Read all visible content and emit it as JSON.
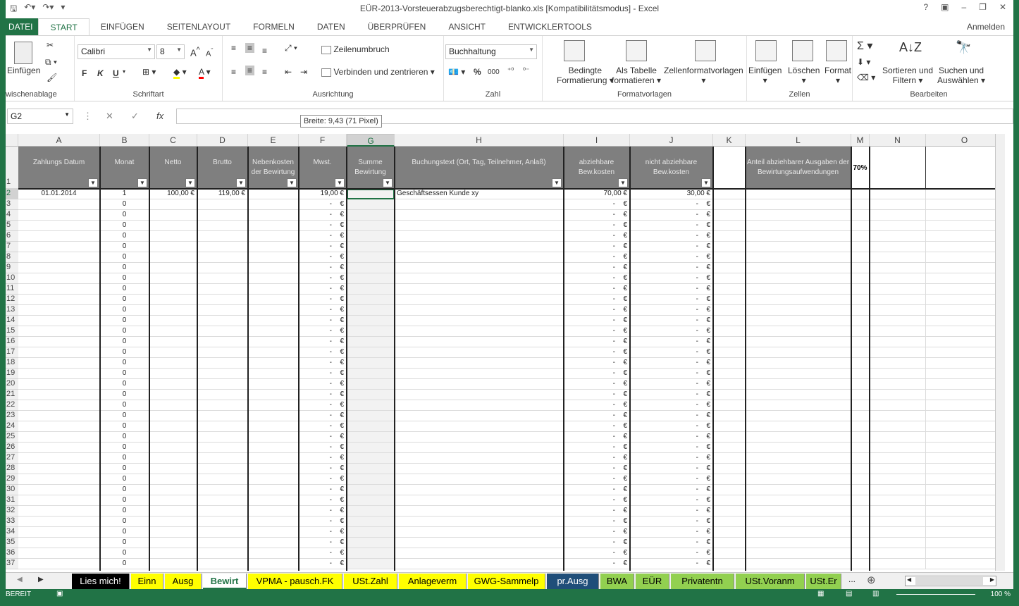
{
  "window": {
    "title": "EÜR-2013-Vorsteuerabzugsberechtigt-blanko.xls  [Kompatibilitätsmodus] - Excel"
  },
  "ribbon": {
    "tabs": [
      "DATEI",
      "START",
      "EINFÜGEN",
      "SEITENLAYOUT",
      "FORMELN",
      "DATEN",
      "ÜBERPRÜFEN",
      "ANSICHT",
      "ENTWICKLERTOOLS"
    ],
    "active_tab": "START",
    "signin": "Anmelden",
    "clipboard": {
      "paste": "Einfügen",
      "label": "wischenablage"
    },
    "font": {
      "name": "Calibri",
      "size": "8",
      "bold": "F",
      "italic": "K",
      "underline": "U",
      "label": "Schriftart"
    },
    "alignment": {
      "wrap": "Zeilenumbruch",
      "merge": "Verbinden und zentrieren",
      "label": "Ausrichtung"
    },
    "number": {
      "format": "Buchhaltung",
      "percent": "%",
      "thousands": "000",
      "label": "Zahl"
    },
    "styles": {
      "conditional_1": "Bedingte",
      "conditional_2": "Formatierung",
      "table_1": "Als Tabelle",
      "table_2": "formatieren",
      "cellstyles": "Zellenformatvorlagen",
      "label": "Formatvorlagen"
    },
    "cells": {
      "insert": "Einfügen",
      "delete": "Löschen",
      "format": "Format",
      "label": "Zellen"
    },
    "editing": {
      "sort_1": "Sortieren und",
      "sort_2": "Filtern",
      "find_1": "Suchen und",
      "find_2": "Auswählen",
      "label": "Bearbeiten"
    }
  },
  "formula_bar": {
    "name_box": "G2",
    "fx": "fx",
    "tooltip": "Breite: 9,43 (71 Pixel)"
  },
  "columns": [
    "A",
    "B",
    "C",
    "D",
    "E",
    "F",
    "G",
    "H",
    "I",
    "J",
    "K",
    "L",
    "M",
    "N",
    "O"
  ],
  "headers": {
    "A": "Zahlungs Datum",
    "B": "Monat",
    "C": "Netto",
    "D": "Brutto",
    "E": "Nebenkosten der Bewirtung",
    "F": "Mwst.",
    "G": "Summe Bewirtung",
    "H": "Buchungstext (Ort, Tag, Teilnehmer, Anlaß)",
    "I": "abziehbare Bew.kosten",
    "J": "nicht abziehbare Bew.kosten",
    "L": "Anteil abziehbarer Ausgaben der Bewirtungsaufwendungen",
    "M": "70%"
  },
  "first_row": {
    "A": "01.01.2014",
    "B": "1",
    "C": "100,00 €",
    "D": "119,00 €",
    "F": "19,00 €",
    "H": "Geschäftsessen Kunde xy",
    "I": "70,00 €",
    "J": "30,00 €"
  },
  "empty_row": {
    "B": "0",
    "dash": "-",
    "euro": "€"
  },
  "row_numbers": [
    "1",
    "2",
    "3",
    "4",
    "5",
    "6",
    "7",
    "8",
    "9",
    "10",
    "11",
    "12",
    "13",
    "14",
    "15",
    "16",
    "17",
    "18",
    "19",
    "20",
    "21",
    "22",
    "23",
    "24",
    "25",
    "26",
    "27",
    "28",
    "29",
    "30",
    "31",
    "32",
    "33",
    "34",
    "35",
    "36",
    "37"
  ],
  "sheet_tabs": [
    {
      "name": "Lies mich!",
      "bg": "#000000",
      "fg": "#ffffff"
    },
    {
      "name": "Einn",
      "bg": "#ffff00",
      "fg": "#000000"
    },
    {
      "name": "Ausg",
      "bg": "#ffff00",
      "fg": "#000000"
    },
    {
      "name": "Bewirt",
      "bg": "#ffffff",
      "fg": "#217346",
      "active": true
    },
    {
      "name": "VPMA - pausch.FK",
      "bg": "#ffff00",
      "fg": "#000000"
    },
    {
      "name": "USt.Zahl",
      "bg": "#ffff00",
      "fg": "#000000"
    },
    {
      "name": "Anlageverm",
      "bg": "#ffff00",
      "fg": "#000000"
    },
    {
      "name": "GWG-Sammelp",
      "bg": "#ffff00",
      "fg": "#000000"
    },
    {
      "name": "pr.Ausg",
      "bg": "#1f4e79",
      "fg": "#ffffff"
    },
    {
      "name": "BWA",
      "bg": "#92d050",
      "fg": "#000000"
    },
    {
      "name": "EÜR",
      "bg": "#92d050",
      "fg": "#000000"
    },
    {
      "name": "Privatentn",
      "bg": "#92d050",
      "fg": "#000000"
    },
    {
      "name": "USt.Voranm",
      "bg": "#92d050",
      "fg": "#000000"
    },
    {
      "name": "USt.Er",
      "bg": "#92d050",
      "fg": "#000000"
    }
  ],
  "sheet_more": "...",
  "status": {
    "mode": "BEREIT",
    "zoom": "100 %"
  },
  "colors": {
    "accent": "#217346",
    "header_fill": "#7f7f7f"
  }
}
